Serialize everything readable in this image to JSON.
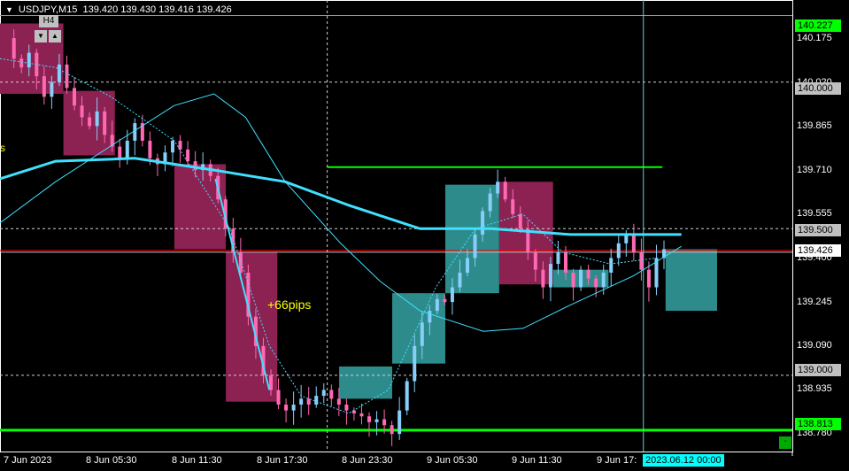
{
  "header": {
    "symbol": "USDJPY,M15",
    "open": "139.420",
    "high": "139.430",
    "low": "139.416",
    "close": "139.426"
  },
  "timeframe": {
    "label": "H4",
    "down_glyph": "▼",
    "up_glyph": "▲"
  },
  "annotation": {
    "pips": "+66pips",
    "left_mark": "s"
  },
  "price_axis": {
    "ticks": [
      "140.175",
      "140.020",
      "139.865",
      "139.710",
      "139.555",
      "139.400",
      "139.245",
      "139.090",
      "138.935",
      "138.780"
    ],
    "tags": [
      {
        "value": "140.227",
        "style": "green"
      },
      {
        "value": "140.000",
        "style": "grey"
      },
      {
        "value": "139.500",
        "style": "grey"
      },
      {
        "value": "139.426",
        "style": "white"
      },
      {
        "value": "139.000",
        "style": "grey"
      },
      {
        "value": "138.813",
        "style": "green"
      }
    ]
  },
  "time_axis": {
    "labels": [
      "7 Jun 2023",
      "8 Jun 05:30",
      "8 Jun 11:30",
      "8 Jun 17:30",
      "8 Jun 23:30",
      "9 Jun 05:30",
      "9 Jun 11:30",
      "9 Jun 17:"
    ],
    "crosshair_time": "2023.06.12 00:00"
  },
  "corner_button": "-",
  "colors": {
    "bull": "#87cefa",
    "bear": "#ff69b4",
    "bull_box": "#2e8b8b",
    "bear_box": "#8b2252",
    "ma": "#40e0ff",
    "level": "#00ff00",
    "current": "#ff0000"
  },
  "chart_data": {
    "type": "candlestick",
    "symbol": "USDJPY",
    "timeframe": "M15",
    "ylim": [
      138.74,
      140.28
    ],
    "levels": {
      "green_top": 140.227,
      "green_bottom": 138.813,
      "round_levels": [
        140.0,
        139.5,
        139.0
      ],
      "current": 139.426
    },
    "h4_boxes": [
      {
        "x0": 0.0,
        "x1": 0.08,
        "open": 140.2,
        "close": 139.96,
        "dir": "down"
      },
      {
        "x0": 0.08,
        "x1": 0.145,
        "open": 139.97,
        "close": 139.75,
        "dir": "down"
      },
      {
        "x0": 0.22,
        "x1": 0.285,
        "open": 139.72,
        "close": 139.43,
        "dir": "down"
      },
      {
        "x0": 0.285,
        "x1": 0.35,
        "open": 139.42,
        "close": 138.91,
        "dir": "down"
      },
      {
        "x0": 0.428,
        "x1": 0.495,
        "open": 138.92,
        "close": 139.03,
        "dir": "up"
      },
      {
        "x0": 0.495,
        "x1": 0.562,
        "open": 139.04,
        "close": 139.28,
        "dir": "up"
      },
      {
        "x0": 0.562,
        "x1": 0.63,
        "open": 139.28,
        "close": 139.65,
        "dir": "up"
      },
      {
        "x0": 0.63,
        "x1": 0.698,
        "open": 139.66,
        "close": 139.31,
        "dir": "down"
      },
      {
        "x0": 0.698,
        "x1": 0.768,
        "open": 139.3,
        "close": 139.36,
        "dir": "up"
      },
      {
        "x0": 0.84,
        "x1": 0.905,
        "open": 139.43,
        "close": 139.22,
        "dir": "up"
      }
    ],
    "close_path": [
      140.15,
      140.08,
      140.05,
      140.1,
      140.02,
      139.95,
      140.0,
      140.06,
      139.98,
      139.92,
      139.88,
      139.85,
      139.9,
      139.82,
      139.78,
      139.74,
      139.8,
      139.86,
      139.8,
      139.74,
      139.72,
      139.76,
      139.8,
      139.77,
      139.73,
      139.7,
      139.72,
      139.68,
      139.6,
      139.5,
      139.42,
      139.35,
      139.2,
      139.1,
      139.0,
      138.95,
      138.9,
      138.88,
      138.9,
      138.92,
      138.9,
      138.93,
      138.95,
      138.92,
      138.9,
      138.88,
      138.87,
      138.86,
      138.84,
      138.85,
      138.83,
      138.8,
      138.88,
      138.98,
      139.1,
      139.18,
      139.22,
      139.26,
      139.25,
      139.3,
      139.35,
      139.4,
      139.48,
      139.56,
      139.62,
      139.66,
      139.6,
      139.55,
      139.5,
      139.42,
      139.36,
      139.3,
      139.38,
      139.42,
      139.35,
      139.3,
      139.36,
      139.33,
      139.3,
      139.35,
      139.4,
      139.45,
      139.48,
      139.42,
      139.36,
      139.3,
      139.4,
      139.43
    ],
    "ma_slow": [
      [
        0.0,
        139.67
      ],
      [
        0.07,
        139.73
      ],
      [
        0.17,
        139.74
      ],
      [
        0.27,
        139.7
      ],
      [
        0.36,
        139.66
      ],
      [
        0.44,
        139.58
      ],
      [
        0.53,
        139.5
      ],
      [
        0.62,
        139.5
      ],
      [
        0.72,
        139.48
      ],
      [
        0.86,
        139.48
      ]
    ],
    "ma_fast": [
      [
        0.0,
        139.52
      ],
      [
        0.07,
        139.66
      ],
      [
        0.15,
        139.8
      ],
      [
        0.22,
        139.92
      ],
      [
        0.27,
        139.96
      ],
      [
        0.31,
        139.88
      ],
      [
        0.36,
        139.66
      ],
      [
        0.43,
        139.45
      ],
      [
        0.48,
        139.32
      ],
      [
        0.53,
        139.22
      ],
      [
        0.61,
        139.15
      ],
      [
        0.66,
        139.16
      ],
      [
        0.72,
        139.24
      ],
      [
        0.8,
        139.34
      ],
      [
        0.86,
        139.44
      ]
    ],
    "ma_dashed": [
      [
        0.0,
        140.08
      ],
      [
        0.07,
        140.05
      ],
      [
        0.14,
        139.95
      ],
      [
        0.22,
        139.8
      ],
      [
        0.29,
        139.5
      ],
      [
        0.34,
        139.1
      ],
      [
        0.38,
        138.93
      ],
      [
        0.44,
        138.87
      ],
      [
        0.49,
        138.95
      ],
      [
        0.55,
        139.3
      ],
      [
        0.6,
        139.5
      ],
      [
        0.66,
        139.55
      ],
      [
        0.71,
        139.42
      ],
      [
        0.77,
        139.38
      ],
      [
        0.83,
        139.4
      ]
    ],
    "swing_line": [
      [
        0.272,
        139.67
      ],
      [
        0.34,
        138.95
      ]
    ],
    "trendline_upper": {
      "x0": 0.413,
      "x1": 0.836,
      "price": 139.71
    },
    "vertical_lines": [
      0.413,
      0.812
    ]
  }
}
